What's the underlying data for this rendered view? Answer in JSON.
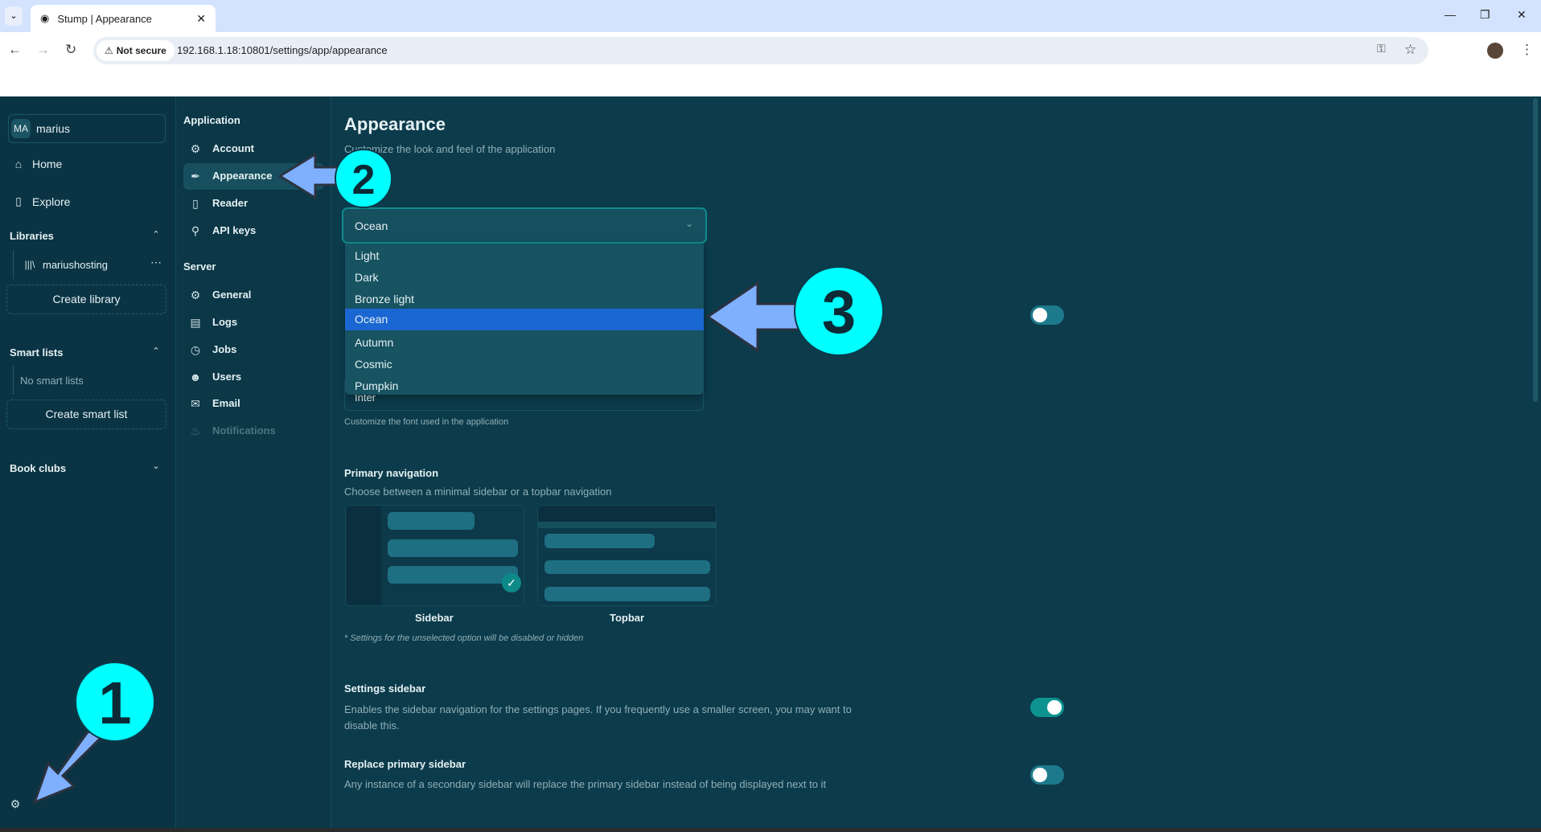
{
  "browser": {
    "tab_title": "Stump | Appearance",
    "not_secure": "Not secure",
    "url": "192.168.1.18:10801/settings/app/appearance"
  },
  "sidebar": {
    "user_initials": "MA",
    "user_name": "marius",
    "home": "Home",
    "explore": "Explore",
    "libraries_heading": "Libraries",
    "library_item": "mariushosting",
    "create_library": "Create library",
    "smart_lists_heading": "Smart lists",
    "no_smart_lists": "No smart lists",
    "create_smart_list": "Create smart list",
    "book_clubs_heading": "Book clubs"
  },
  "settings_nav": {
    "application_heading": "Application",
    "account": "Account",
    "appearance": "Appearance",
    "reader": "Reader",
    "api_keys": "API keys",
    "server_heading": "Server",
    "general": "General",
    "logs": "Logs",
    "jobs": "Jobs",
    "users": "Users",
    "email": "Email",
    "notifications": "Notifications"
  },
  "main": {
    "title": "Appearance",
    "subtitle": "Customize the look and feel of the application",
    "theme_select": {
      "value": "Ocean",
      "options": [
        "Light",
        "Dark",
        "Bronze light",
        "Ocean",
        "Autumn",
        "Cosmic",
        "Pumpkin"
      ]
    },
    "font_select_value": "Inter",
    "font_help": "Customize the font used in the application",
    "primary_nav_title": "Primary navigation",
    "primary_nav_desc": "Choose between a minimal sidebar or a topbar navigation",
    "sidebar_option": "Sidebar",
    "topbar_option": "Topbar",
    "selected_option": "Sidebar",
    "nav_note": "* Settings for the unselected option will be disabled or hidden",
    "settings_sidebar_title": "Settings sidebar",
    "settings_sidebar_desc": "Enables the sidebar navigation for the settings pages. If you frequently use a smaller screen, you may want to disable this.",
    "settings_sidebar_on": true,
    "replace_sidebar_title": "Replace primary sidebar",
    "replace_sidebar_desc": "Any instance of a secondary sidebar will replace the primary sidebar instead of being displayed next to it",
    "replace_sidebar_on": false,
    "hidden_toggle_on": false
  },
  "annotations": {
    "step1": "1",
    "step2": "2",
    "step3": "3"
  },
  "colors": {
    "accent": "#0d9490",
    "selected_option": "#1a66d2",
    "annotation_circle": "#00ffff",
    "annotation_arrow": "#7fb0ff"
  }
}
